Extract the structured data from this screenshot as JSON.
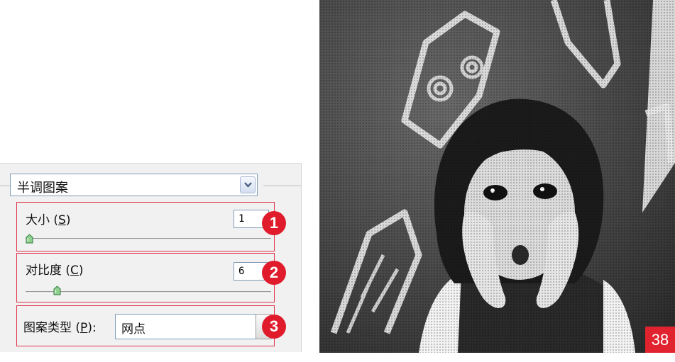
{
  "filter_dropdown": {
    "value": "半调图案"
  },
  "size": {
    "label_pre": "大小 (",
    "mnemonic": "S",
    "label_post": ")",
    "value": "1",
    "slider_level": 0.0
  },
  "contrast": {
    "label_pre": "对比度 (",
    "mnemonic": "C",
    "label_post": ")",
    "value": "6",
    "slider_level": 0.12
  },
  "pattern_type": {
    "label_pre": "图案类型 (",
    "mnemonic": "P",
    "label_post": "):",
    "value": "网点"
  },
  "badges": [
    "1",
    "2",
    "3"
  ],
  "page_number": "38",
  "colors": {
    "badge": "#e01b2c",
    "highlight_border": "#e0324a",
    "page_tag": "#e0232e"
  }
}
